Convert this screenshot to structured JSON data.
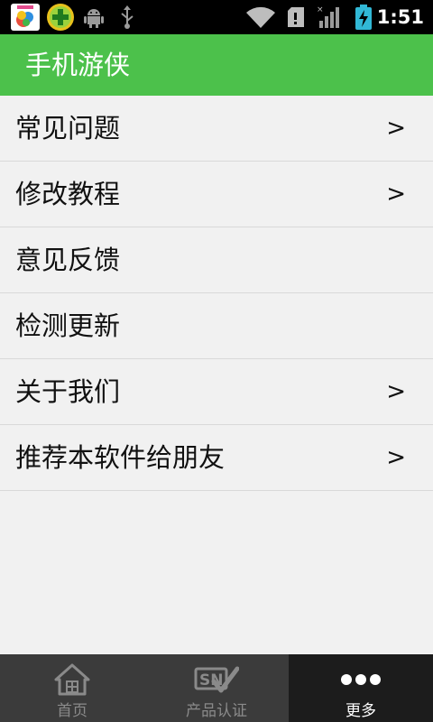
{
  "status_bar": {
    "time": "1:51",
    "icons": [
      "photo-app-icon",
      "add-app-icon",
      "android-icon",
      "usb-icon",
      "wifi-icon",
      "sd-card-icon",
      "signal-icon",
      "battery-charging-icon"
    ]
  },
  "header": {
    "title": "手机游侠"
  },
  "menu": {
    "items": [
      {
        "label": "常见问题",
        "arrow": ">"
      },
      {
        "label": "修改教程",
        "arrow": ">"
      },
      {
        "label": "意见反馈",
        "arrow": ""
      },
      {
        "label": "检测更新",
        "arrow": ""
      },
      {
        "label": "关于我们",
        "arrow": ">"
      },
      {
        "label": "推荐本软件给朋友",
        "arrow": ">"
      }
    ]
  },
  "tabs": [
    {
      "label": "首页",
      "icon": "home-icon"
    },
    {
      "label": "产品认证",
      "icon": "sn-verified-icon"
    },
    {
      "label": "更多",
      "icon": "more-dots-icon",
      "active": true
    }
  ],
  "colors": {
    "accent": "#4cc14b",
    "tabbar": "#3b3b3b",
    "tab_active": "#1c1c1c"
  }
}
